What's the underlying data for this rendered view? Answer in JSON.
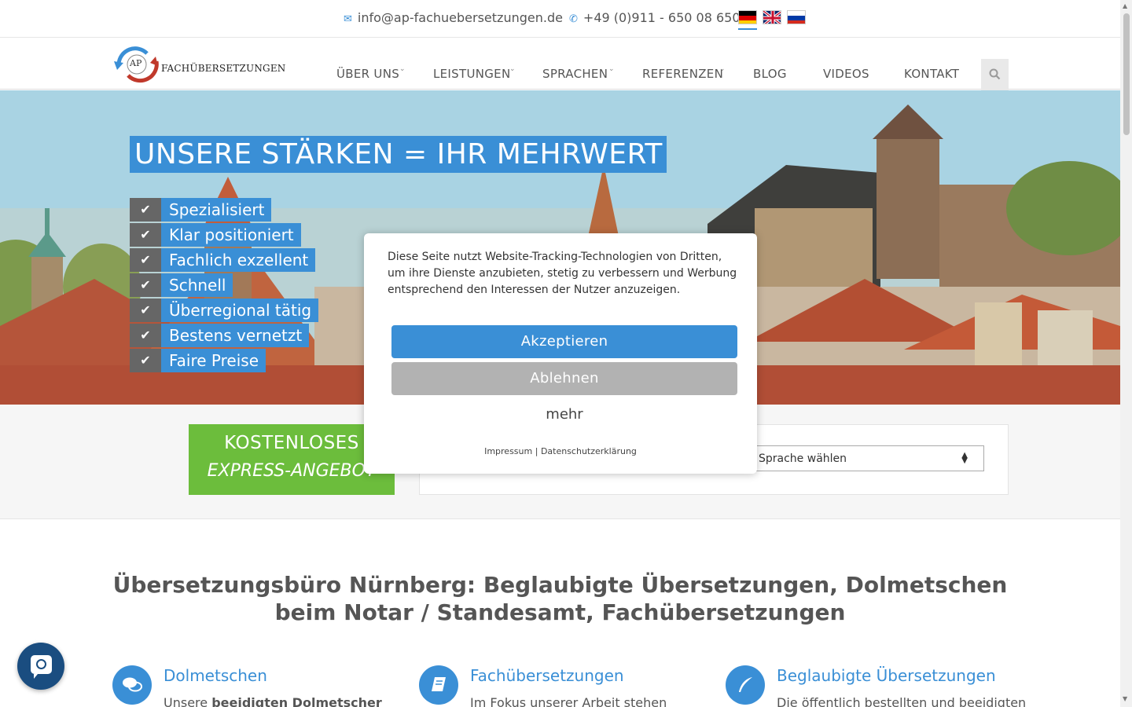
{
  "topbar": {
    "email": "info@ap-fachuebersetzungen.de",
    "phone": "+49 (0)911 - 650 08 650",
    "email_icon": "envelope-icon",
    "phone_icon": "phone-icon",
    "languages": [
      "de",
      "en",
      "ru"
    ],
    "active_language": "de"
  },
  "header": {
    "logo_badge": "AP",
    "logo_text": "FACHÜBERSETZUNGEN",
    "nav": [
      {
        "label": "ÜBER UNS",
        "dropdown": true
      },
      {
        "label": "LEISTUNGEN",
        "dropdown": true
      },
      {
        "label": "SPRACHEN",
        "dropdown": true
      },
      {
        "label": "REFERENZEN",
        "dropdown": true
      },
      {
        "label": "BLOG",
        "dropdown": false
      },
      {
        "label": "VIDEOS",
        "dropdown": false
      },
      {
        "label": "KONTAKT",
        "dropdown": false
      }
    ],
    "search_icon": "search-icon"
  },
  "hero": {
    "title": "UNSERE STÄRKEN = IHR MEHRWERT",
    "features": [
      "Spezialisiert",
      "Klar positioniert",
      "Fachlich exzellent",
      "Schnell",
      "Überregional tätig",
      "Bestens vernetzt",
      "Faire Preise"
    ]
  },
  "quote": {
    "button_line1": "KOSTENLOSES",
    "button_line2": "EXPRESS-ANGEBOT",
    "language_select": "Sprache wählen"
  },
  "main": {
    "heading": "Übersetzungsbüro Nürnberg: Beglaubigte Übersetzungen, Dolmetschen beim Notar / Standesamt, Fachübersetzungen",
    "services": [
      {
        "title": "Dolmetschen",
        "text_plain": "Unsere ",
        "text_bold": "beeidigten Dolmetscher",
        "icon": "chat-bubbles-icon"
      },
      {
        "title": "Fachübersetzungen",
        "text_plain": "Im Fokus unserer Arbeit stehen",
        "text_bold": "",
        "icon": "book-icon"
      },
      {
        "title": "Beglaubigte Übersetzungen",
        "text_plain": "Die öffentlich bestellten und beeidigten",
        "text_bold": "",
        "icon": "quill-icon"
      }
    ]
  },
  "cookie": {
    "text": "Diese Seite nutzt Website-Tracking-Technologien von Dritten, um ihre Dienste anzubieten, stetig zu verbessern und Werbung entsprechend den Interessen der Nutzer anzuzeigen.",
    "accept": "Akzeptieren",
    "decline": "Ablehnen",
    "more": "mehr",
    "impressum": "Impressum",
    "separator": "|",
    "privacy": "Datenschutzerklärung"
  },
  "colors": {
    "accent": "#3a8fd6",
    "green": "#6cbd3c",
    "decline_gray": "#b2b2b2",
    "chat": "#1a4d80"
  }
}
